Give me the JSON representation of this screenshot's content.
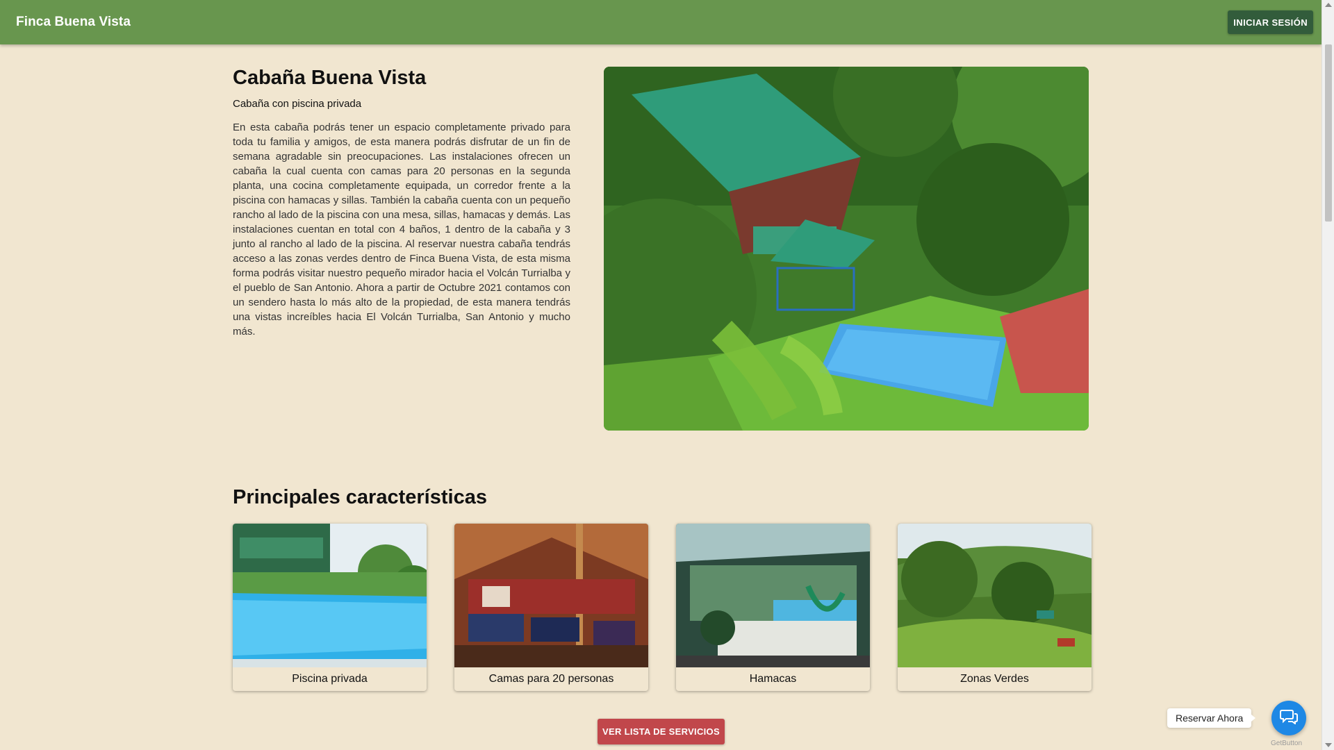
{
  "header": {
    "brand": "Finca Buena Vista",
    "login_label": "INICIAR SESIÓN"
  },
  "intro": {
    "title": "Cabaña Buena Vista",
    "subtitle": "Cabaña con piscina privada",
    "description": "En esta cabaña podrás tener un espacio completamente privado para toda tu familia y amigos, de esta manera podrás disfrutar de un fin de semana agradable sin preocupaciones. Las instalaciones ofrecen un cabaña la cual cuenta con camas para 20 personas en la segunda planta, una cocina completamente equipada, un corredor frente a la piscina con hamacas y sillas. También la cabaña cuenta con un pequeño rancho al lado de la piscina con una mesa, sillas, hamacas y demás. Las instalaciones cuentan en total con 4 baños, 1 dentro de la cabaña y 3 junto al rancho al lado de la piscina. Al reservar nuestra cabaña tendrás acceso a las zonas verdes dentro de Finca Buena Vista, de esta misma forma podrás visitar nuestro pequeño mirador hacia el Volcán Turrialba y el pueblo de San Antonio. Ahora a partir de Octubre 2021 contamos con un sendero hasta lo más alto de la propiedad, de esta manera tendrás una vistas increíbles hacia El Volcán Turrialba, San Antonio y mucho más."
  },
  "features": {
    "title": "Principales características",
    "cards": [
      {
        "label": "Piscina privada"
      },
      {
        "label": "Camas para 20 personas"
      },
      {
        "label": "Hamacas"
      },
      {
        "label": "Zonas Verdes"
      }
    ],
    "services_button": "VER LISTA DE SERVICIOS"
  },
  "chat": {
    "label": "Reservar Ahora",
    "icon": "chat-bubbles-icon",
    "credit": "GetButton"
  },
  "colors": {
    "appbar": "#68964e",
    "login_button": "#325c3b",
    "page_background": "#f1e6d0",
    "services_button": "#c1474b",
    "chat_button": "#1e88e5"
  }
}
